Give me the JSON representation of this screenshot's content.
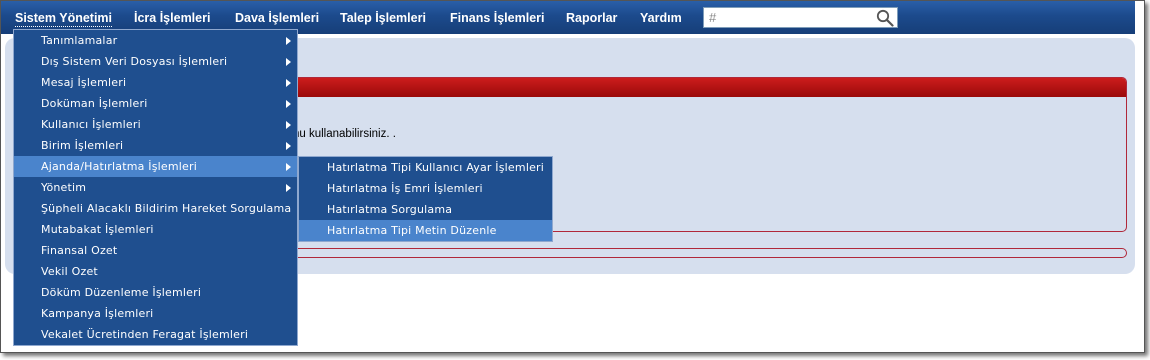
{
  "menubar": {
    "items": [
      {
        "label": "Sistem Yönetimi"
      },
      {
        "label": "İcra İşlemleri"
      },
      {
        "label": "Dava İşlemleri"
      },
      {
        "label": "Talep İşlemleri"
      },
      {
        "label": "Finans İşlemleri"
      },
      {
        "label": "Raporlar"
      },
      {
        "label": "Yardım"
      }
    ],
    "search": {
      "value": "#",
      "icon": "search-icon"
    }
  },
  "content": {
    "info_text": "nu kullanabilirsiniz. ."
  },
  "dropdown": {
    "items": [
      {
        "label": "Tanımlamalar",
        "has_submenu": true
      },
      {
        "label": "Dış Sistem Veri Dosyası İşlemleri",
        "has_submenu": true
      },
      {
        "label": "Mesaj İşlemleri",
        "has_submenu": true
      },
      {
        "label": "Doküman İşlemleri",
        "has_submenu": true
      },
      {
        "label": "Kullanıcı İşlemleri",
        "has_submenu": true
      },
      {
        "label": "Birim İşlemleri",
        "has_submenu": true
      },
      {
        "label": "Ajanda/Hatırlatma İşlemleri",
        "has_submenu": true,
        "active": true
      },
      {
        "label": "Yönetim",
        "has_submenu": true
      },
      {
        "label": "Şüpheli Alacaklı Bildirim Hareket Sorgulama"
      },
      {
        "label": "Mutabakat İşlemleri"
      },
      {
        "label": "Finansal Ozet"
      },
      {
        "label": "Vekil Ozet"
      },
      {
        "label": "Döküm Düzenleme İşlemleri"
      },
      {
        "label": "Kampanya İşlemleri"
      },
      {
        "label": "Vekalet Ücretinden Feragat İşlemleri"
      }
    ]
  },
  "submenu": {
    "items": [
      {
        "label": "Hatırlatma Tipi Kullanıcı Ayar İşlemleri"
      },
      {
        "label": "Hatırlatma İş Emri İşlemleri"
      },
      {
        "label": "Hatırlatma Sorgulama"
      },
      {
        "label": "Hatırlatma Tipi Metin Düzenle",
        "active": true
      }
    ]
  },
  "colors": {
    "menubar": "#1c4a8c",
    "menu_bg": "#1f4f8f",
    "menu_highlight": "#4a84cc",
    "content_bg": "#d6dfee",
    "panel_header": "#b01414"
  }
}
